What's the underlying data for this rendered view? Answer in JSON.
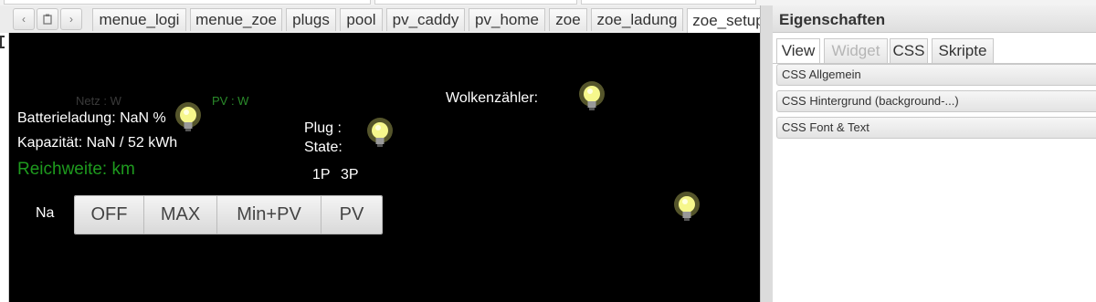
{
  "tabs": [
    "menue_logi",
    "menue_zoe",
    "plugs",
    "pool",
    "pv_caddy",
    "pv_home",
    "zoe",
    "zoe_ladung",
    "zoe_setup"
  ],
  "active_tab": "zoe_setup",
  "nav": {
    "prev": "‹",
    "clipboard": "⎗",
    "next": "›"
  },
  "canvas": {
    "netz": "Netz : W",
    "pv": "PV : W",
    "batterie": "Batterieladung: NaN %",
    "kapazitaet": "Kapazität: NaN / 52 kWh",
    "reichweite": "Reichweite: km",
    "plug": "Plug :",
    "state": "State:",
    "phase1": "1P",
    "phase3": "3P",
    "wolken": "Wolkenzähler:",
    "na": "Na",
    "buttons": [
      "OFF",
      "MAX",
      "Min+PV",
      "PV"
    ]
  },
  "panel": {
    "title": "Eigenschaften",
    "tabs": [
      "View",
      "Widget",
      "CSS",
      "Skripte"
    ],
    "sections": [
      "CSS Allgemein",
      "CSS Hintergrund (background-...)",
      "CSS Font & Text"
    ]
  },
  "colors": {
    "canvas_bg": "#000000",
    "green_text": "#1e9a1e",
    "dim_text": "#3a3a3a",
    "pv_text": "#2a8a2a",
    "bulb_glow": "#f3f47a"
  }
}
